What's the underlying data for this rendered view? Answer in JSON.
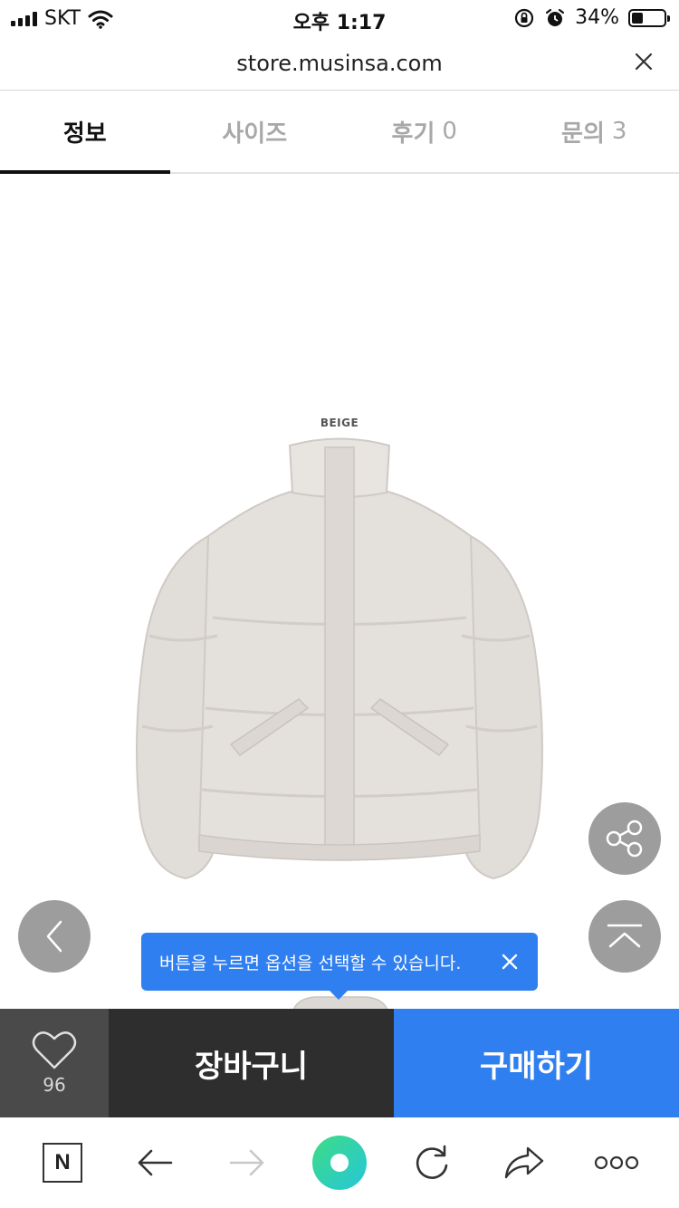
{
  "status_bar": {
    "carrier": "SKT",
    "time": "오후 1:17",
    "battery_percent_text": "34%",
    "battery_level": 0.34
  },
  "url_bar": {
    "url": "store.musinsa.com",
    "close_icon": "close-icon"
  },
  "tabs": [
    {
      "label": "정보",
      "count": "",
      "active": true
    },
    {
      "label": "사이즈",
      "count": "",
      "active": false
    },
    {
      "label": "후기",
      "count": "0",
      "active": false
    },
    {
      "label": "문의",
      "count": "3",
      "active": false
    }
  ],
  "product": {
    "color_label": "BEIGE"
  },
  "floating_buttons": {
    "share_icon": "share-icon",
    "top_icon": "scroll-top-icon",
    "prev_icon": "chevron-left-icon"
  },
  "tooltip": {
    "text": "버튼을 누르면 옵션을 선택할 수 있습니다."
  },
  "actions": {
    "like_count": "96",
    "cart_label": "장바구니",
    "buy_label": "구매하기"
  },
  "browser_toolbar": {
    "n_label": "N",
    "icons": [
      "naver-home-icon",
      "back-arrow-icon",
      "forward-arrow-icon",
      "green-dot-icon",
      "reload-icon",
      "share-arrow-icon",
      "more-icon"
    ]
  },
  "colors": {
    "accent_blue": "#2f7ff0",
    "cart_dark": "#2e2e2e",
    "like_gray": "#4a4a4a",
    "jacket_beige": "#e1ddd9"
  }
}
